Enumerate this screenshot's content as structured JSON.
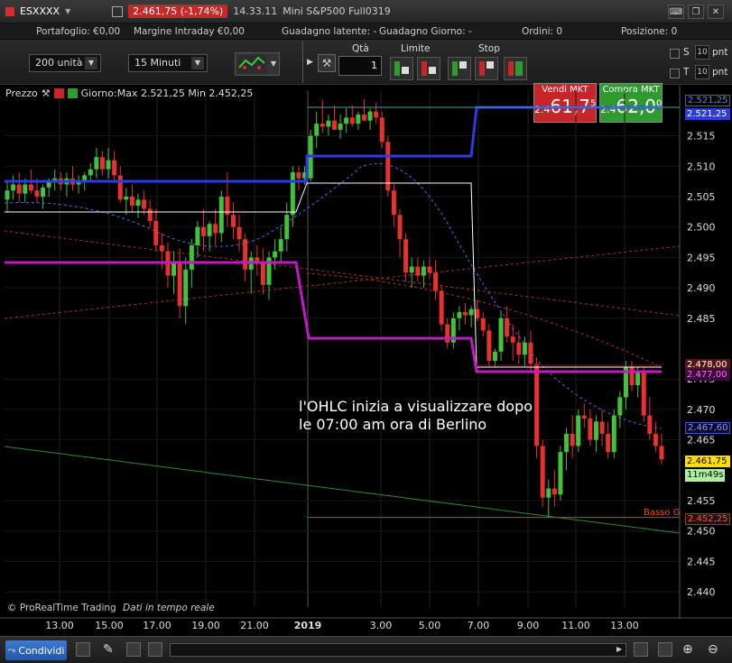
{
  "titlebar": {
    "symbol": "ESXXXX",
    "price_change": "2.461,75 (-1,74%)",
    "time": "14.33.11",
    "instrument": "Mini S&P500 Full0319"
  },
  "account": {
    "portafoglio": "Portafoglio: €0,00",
    "margine": "Margine Intraday €0,00",
    "guadagno_latente": "Guadagno latente: -",
    "guadagno_giorno": "Guadagno Giorno: -",
    "ordini": "Ordini: 0",
    "posizione": "Posizione: 0"
  },
  "toolbar": {
    "quantity_select": "200 unità",
    "timeframe_select": "15 Minuti",
    "qty_label": "Qtà",
    "qty_value": "1",
    "limit_label": "Limite",
    "stop_label": "Stop",
    "sell_label": "Vendi MKT",
    "sell_prefix": "2.4",
    "sell_price": "61,7",
    "sell_sup": "5",
    "buy_label": "Compra MKT",
    "buy_prefix": "2.4",
    "buy_price": "62,0",
    "buy_sup": "0",
    "s_label": "S",
    "t_label": "T",
    "s_value": "10",
    "t_value": "10",
    "pnt": "pnt"
  },
  "chart_header": {
    "label": "Prezzo",
    "info": "Giorno:Max 2.521,25 Min 2.452,25"
  },
  "annotation": {
    "line1": "l'OHLC inizia a visualizzare dopo",
    "line2": "le 07:00 am ora di Berlino"
  },
  "footer_text": {
    "brand": "© ProRealTime Trading",
    "realtime": "Dati in tempo reale"
  },
  "price_labels": {
    "max_blue": "2.521,25",
    "max_blue2": "2.521,25",
    "red_level": "2.478,00",
    "magenta_level": "2.477,00",
    "blue_dash_level": "2.467,60",
    "current": "2.461,75",
    "countdown": "11m49s",
    "low": "2.452,25",
    "low_text": "Basso G"
  },
  "colors": {
    "up": "#41c23a",
    "down": "#e8302e",
    "max_line": "#2e3be0",
    "pivot_line": "#c318c3",
    "white_line": "#ffffff",
    "dash_blue": "#5566ee",
    "dash_red": "#aa3030",
    "green_trend": "#2d8a2d",
    "current_badge": "#ffdd00"
  },
  "icons": {
    "share": "share-icon",
    "wrench": "wrench-icon",
    "zoom_in": "zoom-in-icon",
    "zoom_out": "zoom-out-icon",
    "search": "search-icon",
    "settings": "gear-icon"
  },
  "bottom": {
    "share_label": "Condividi"
  },
  "chart_data": {
    "type": "candlestick",
    "x_ticks": [
      "13.00",
      "15.00",
      "17.00",
      "19.00",
      "21.00",
      "2019",
      "3.00",
      "5.00",
      "7.00",
      "9.00",
      "11.00",
      "13.00"
    ],
    "y_ticks": [
      2.515,
      2.51,
      2.505,
      2.5,
      2.495,
      2.49,
      2.485,
      2.475,
      2.47,
      2.465,
      2.455,
      2.45,
      2.445,
      2.44
    ],
    "y_tick_labels": [
      "2.515",
      "2.510",
      "2.505",
      "2.500",
      "2.495",
      "2.490",
      "2.485",
      "2.475",
      "2.470",
      "2.465",
      "2.455",
      "2.450",
      "2.445",
      "2.440"
    ],
    "ylim": [
      2.4375,
      2.5225
    ],
    "candles": [
      {
        "o": 2.5045,
        "h": 2.5075,
        "l": 2.5025,
        "c": 2.506
      },
      {
        "o": 2.506,
        "h": 2.5085,
        "l": 2.5045,
        "c": 2.507
      },
      {
        "o": 2.507,
        "h": 2.509,
        "l": 2.504,
        "c": 2.5055
      },
      {
        "o": 2.5055,
        "h": 2.508,
        "l": 2.504,
        "c": 2.507
      },
      {
        "o": 2.507,
        "h": 2.5095,
        "l": 2.5055,
        "c": 2.506
      },
      {
        "o": 2.506,
        "h": 2.508,
        "l": 2.504,
        "c": 2.505
      },
      {
        "o": 2.505,
        "h": 2.507,
        "l": 2.503,
        "c": 2.5065
      },
      {
        "o": 2.5065,
        "h": 2.508,
        "l": 2.505,
        "c": 2.5075
      },
      {
        "o": 2.5075,
        "h": 2.5095,
        "l": 2.506,
        "c": 2.508
      },
      {
        "o": 2.508,
        "h": 2.509,
        "l": 2.506,
        "c": 2.507
      },
      {
        "o": 2.507,
        "h": 2.509,
        "l": 2.505,
        "c": 2.508
      },
      {
        "o": 2.508,
        "h": 2.51,
        "l": 2.506,
        "c": 2.507
      },
      {
        "o": 2.507,
        "h": 2.5085,
        "l": 2.5055,
        "c": 2.5075
      },
      {
        "o": 2.5075,
        "h": 2.509,
        "l": 2.506,
        "c": 2.5085
      },
      {
        "o": 2.5085,
        "h": 2.5105,
        "l": 2.5075,
        "c": 2.5095
      },
      {
        "o": 2.5095,
        "h": 2.513,
        "l": 2.508,
        "c": 2.5115
      },
      {
        "o": 2.5115,
        "h": 2.5125,
        "l": 2.5085,
        "c": 2.5095
      },
      {
        "o": 2.5095,
        "h": 2.513,
        "l": 2.508,
        "c": 2.511
      },
      {
        "o": 2.511,
        "h": 2.5125,
        "l": 2.5075,
        "c": 2.5085
      },
      {
        "o": 2.5085,
        "h": 2.51,
        "l": 2.504,
        "c": 2.5045
      },
      {
        "o": 2.5045,
        "h": 2.5065,
        "l": 2.502,
        "c": 2.505
      },
      {
        "o": 2.505,
        "h": 2.507,
        "l": 2.5025,
        "c": 2.5035
      },
      {
        "o": 2.5035,
        "h": 2.5055,
        "l": 2.5015,
        "c": 2.5045
      },
      {
        "o": 2.5045,
        "h": 2.506,
        "l": 2.502,
        "c": 2.503
      },
      {
        "o": 2.503,
        "h": 2.5045,
        "l": 2.5,
        "c": 2.501
      },
      {
        "o": 2.501,
        "h": 2.503,
        "l": 2.496,
        "c": 2.497
      },
      {
        "o": 2.497,
        "h": 2.499,
        "l": 2.493,
        "c": 2.496
      },
      {
        "o": 2.496,
        "h": 2.4975,
        "l": 2.49,
        "c": 2.492
      },
      {
        "o": 2.492,
        "h": 2.496,
        "l": 2.489,
        "c": 2.494
      },
      {
        "o": 2.494,
        "h": 2.4965,
        "l": 2.485,
        "c": 2.487
      },
      {
        "o": 2.487,
        "h": 2.495,
        "l": 2.484,
        "c": 2.493
      },
      {
        "o": 2.493,
        "h": 2.498,
        "l": 2.49,
        "c": 2.497
      },
      {
        "o": 2.497,
        "h": 2.501,
        "l": 2.495,
        "c": 2.5
      },
      {
        "o": 2.5,
        "h": 2.503,
        "l": 2.496,
        "c": 2.4985
      },
      {
        "o": 2.4985,
        "h": 2.501,
        "l": 2.496,
        "c": 2.5005
      },
      {
        "o": 2.5005,
        "h": 2.503,
        "l": 2.497,
        "c": 2.499
      },
      {
        "o": 2.499,
        "h": 2.506,
        "l": 2.4975,
        "c": 2.505
      },
      {
        "o": 2.505,
        "h": 2.509,
        "l": 2.5,
        "c": 2.502
      },
      {
        "o": 2.502,
        "h": 2.504,
        "l": 2.498,
        "c": 2.5
      },
      {
        "o": 2.5,
        "h": 2.502,
        "l": 2.496,
        "c": 2.498
      },
      {
        "o": 2.498,
        "h": 2.499,
        "l": 2.491,
        "c": 2.493
      },
      {
        "o": 2.493,
        "h": 2.496,
        "l": 2.489,
        "c": 2.495
      },
      {
        "o": 2.495,
        "h": 2.497,
        "l": 2.492,
        "c": 2.494
      },
      {
        "o": 2.494,
        "h": 2.4965,
        "l": 2.489,
        "c": 2.4905
      },
      {
        "o": 2.4905,
        "h": 2.496,
        "l": 2.488,
        "c": 2.495
      },
      {
        "o": 2.495,
        "h": 2.498,
        "l": 2.493,
        "c": 2.496
      },
      {
        "o": 2.496,
        "h": 2.5,
        "l": 2.494,
        "c": 2.498
      },
      {
        "o": 2.498,
        "h": 2.504,
        "l": 2.496,
        "c": 2.502
      },
      {
        "o": 2.502,
        "h": 2.51,
        "l": 2.5,
        "c": 2.509
      },
      {
        "o": 2.509,
        "h": 2.51,
        "l": 2.506,
        "c": 2.508
      },
      {
        "o": 2.508,
        "h": 2.51,
        "l": 2.507,
        "c": 2.509
      },
      {
        "o": 2.508,
        "h": 2.516,
        "l": 2.5075,
        "c": 2.515
      },
      {
        "o": 2.515,
        "h": 2.519,
        "l": 2.513,
        "c": 2.517
      },
      {
        "o": 2.517,
        "h": 2.521,
        "l": 2.5155,
        "c": 2.5165
      },
      {
        "o": 2.5165,
        "h": 2.5185,
        "l": 2.515,
        "c": 2.5175
      },
      {
        "o": 2.5175,
        "h": 2.52,
        "l": 2.516,
        "c": 2.516
      },
      {
        "o": 2.516,
        "h": 2.5185,
        "l": 2.5145,
        "c": 2.517
      },
      {
        "o": 2.517,
        "h": 2.5195,
        "l": 2.5155,
        "c": 2.518
      },
      {
        "o": 2.518,
        "h": 2.52,
        "l": 2.5165,
        "c": 2.517
      },
      {
        "o": 2.517,
        "h": 2.519,
        "l": 2.516,
        "c": 2.5185
      },
      {
        "o": 2.5185,
        "h": 2.521,
        "l": 2.5175,
        "c": 2.5175
      },
      {
        "o": 2.5175,
        "h": 2.5195,
        "l": 2.516,
        "c": 2.519
      },
      {
        "o": 2.519,
        "h": 2.5205,
        "l": 2.517,
        "c": 2.518
      },
      {
        "o": 2.518,
        "h": 2.519,
        "l": 2.513,
        "c": 2.514
      },
      {
        "o": 2.514,
        "h": 2.515,
        "l": 2.505,
        "c": 2.506
      },
      {
        "o": 2.506,
        "h": 2.507,
        "l": 2.5,
        "c": 2.502
      },
      {
        "o": 2.502,
        "h": 2.503,
        "l": 2.495,
        "c": 2.498
      },
      {
        "o": 2.498,
        "h": 2.499,
        "l": 2.491,
        "c": 2.4925
      },
      {
        "o": 2.4925,
        "h": 2.495,
        "l": 2.49,
        "c": 2.4935
      },
      {
        "o": 2.4935,
        "h": 2.495,
        "l": 2.491,
        "c": 2.492
      },
      {
        "o": 2.492,
        "h": 2.4945,
        "l": 2.49,
        "c": 2.4935
      },
      {
        "o": 2.4935,
        "h": 2.495,
        "l": 2.4915,
        "c": 2.4925
      },
      {
        "o": 2.4925,
        "h": 2.4945,
        "l": 2.488,
        "c": 2.4895
      },
      {
        "o": 2.4895,
        "h": 2.4905,
        "l": 2.483,
        "c": 2.484
      },
      {
        "o": 2.484,
        "h": 2.485,
        "l": 2.48,
        "c": 2.481
      },
      {
        "o": 2.481,
        "h": 2.486,
        "l": 2.48,
        "c": 2.485
      },
      {
        "o": 2.485,
        "h": 2.487,
        "l": 2.483,
        "c": 2.486
      },
      {
        "o": 2.486,
        "h": 2.4875,
        "l": 2.484,
        "c": 2.4855
      },
      {
        "o": 2.4855,
        "h": 2.487,
        "l": 2.4835,
        "c": 2.4865
      },
      {
        "o": 2.4865,
        "h": 2.488,
        "l": 2.4845,
        "c": 2.485
      },
      {
        "o": 2.485,
        "h": 2.486,
        "l": 2.482,
        "c": 2.483
      },
      {
        "o": 2.483,
        "h": 2.484,
        "l": 2.477,
        "c": 2.478
      },
      {
        "o": 2.478,
        "h": 2.48,
        "l": 2.477,
        "c": 2.4795
      },
      {
        "o": 2.4795,
        "h": 2.486,
        "l": 2.478,
        "c": 2.485
      },
      {
        "o": 2.485,
        "h": 2.487,
        "l": 2.481,
        "c": 2.482
      },
      {
        "o": 2.482,
        "h": 2.484,
        "l": 2.478,
        "c": 2.481
      },
      {
        "o": 2.481,
        "h": 2.483,
        "l": 2.4775,
        "c": 2.479
      },
      {
        "o": 2.479,
        "h": 2.482,
        "l": 2.477,
        "c": 2.481
      },
      {
        "o": 2.481,
        "h": 2.483,
        "l": 2.476,
        "c": 2.4775
      },
      {
        "o": 2.4775,
        "h": 2.4785,
        "l": 2.462,
        "c": 2.464
      },
      {
        "o": 2.464,
        "h": 2.465,
        "l": 2.454,
        "c": 2.4555
      },
      {
        "o": 2.4555,
        "h": 2.4585,
        "l": 2.4522,
        "c": 2.457
      },
      {
        "o": 2.457,
        "h": 2.46,
        "l": 2.454,
        "c": 2.456
      },
      {
        "o": 2.456,
        "h": 2.464,
        "l": 2.455,
        "c": 2.463
      },
      {
        "o": 2.463,
        "h": 2.467,
        "l": 2.46,
        "c": 2.466
      },
      {
        "o": 2.466,
        "h": 2.469,
        "l": 2.462,
        "c": 2.464
      },
      {
        "o": 2.464,
        "h": 2.47,
        "l": 2.463,
        "c": 2.469
      },
      {
        "o": 2.469,
        "h": 2.471,
        "l": 2.467,
        "c": 2.4685
      },
      {
        "o": 2.4685,
        "h": 2.47,
        "l": 2.464,
        "c": 2.465
      },
      {
        "o": 2.465,
        "h": 2.469,
        "l": 2.463,
        "c": 2.468
      },
      {
        "o": 2.468,
        "h": 2.47,
        "l": 2.464,
        "c": 2.466
      },
      {
        "o": 2.466,
        "h": 2.468,
        "l": 2.462,
        "c": 2.463
      },
      {
        "o": 2.463,
        "h": 2.47,
        "l": 2.462,
        "c": 2.469
      },
      {
        "o": 2.469,
        "h": 2.473,
        "l": 2.467,
        "c": 2.472
      },
      {
        "o": 2.472,
        "h": 2.478,
        "l": 2.47,
        "c": 2.477
      },
      {
        "o": 2.477,
        "h": 2.478,
        "l": 2.473,
        "c": 2.474
      },
      {
        "o": 2.474,
        "h": 2.477,
        "l": 2.472,
        "c": 2.476
      },
      {
        "o": 2.476,
        "h": 2.477,
        "l": 2.468,
        "c": 2.469
      },
      {
        "o": 2.469,
        "h": 2.472,
        "l": 2.465,
        "c": 2.466
      },
      {
        "o": 2.466,
        "h": 2.468,
        "l": 2.463,
        "c": 2.464
      },
      {
        "o": 2.464,
        "h": 2.466,
        "l": 2.461,
        "c": 2.4618
      }
    ],
    "max_line": [
      [
        2.5095,
        2.5095,
        2.5135,
        2.5135,
        2.5213,
        2.5213
      ]
    ],
    "pivot_line": [
      2.4955,
      2.4955,
      2.484,
      2.484,
      2.478,
      2.478
    ],
    "levels": {
      "max": 2.52125,
      "red": 2.478,
      "magenta": 2.477,
      "dash_blue_end": 2.4676,
      "current": 2.46175,
      "low": 2.45225
    }
  }
}
